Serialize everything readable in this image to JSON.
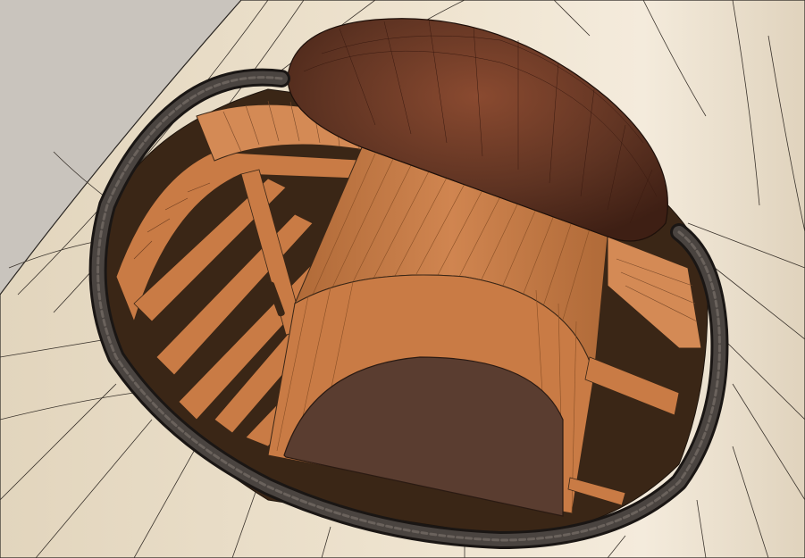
{
  "scene": {
    "subject": "aircraft-cockpit-3d-model",
    "colors": {
      "background": "#c9c4bd",
      "fuselage_skin": "#ece0cb",
      "fuselage_shadow": "#d9ccb5",
      "mesh_lines": "#2a2622",
      "wood": "#c97b45",
      "wood_dark": "#7a4a2a",
      "wood_shadow": "#3a2616",
      "headrest_leather": "#5a3020",
      "headrest_highlight": "#8a4a30",
      "seat_cushion": "#5a3d30",
      "coaming_rubber": "#3a3532"
    }
  }
}
